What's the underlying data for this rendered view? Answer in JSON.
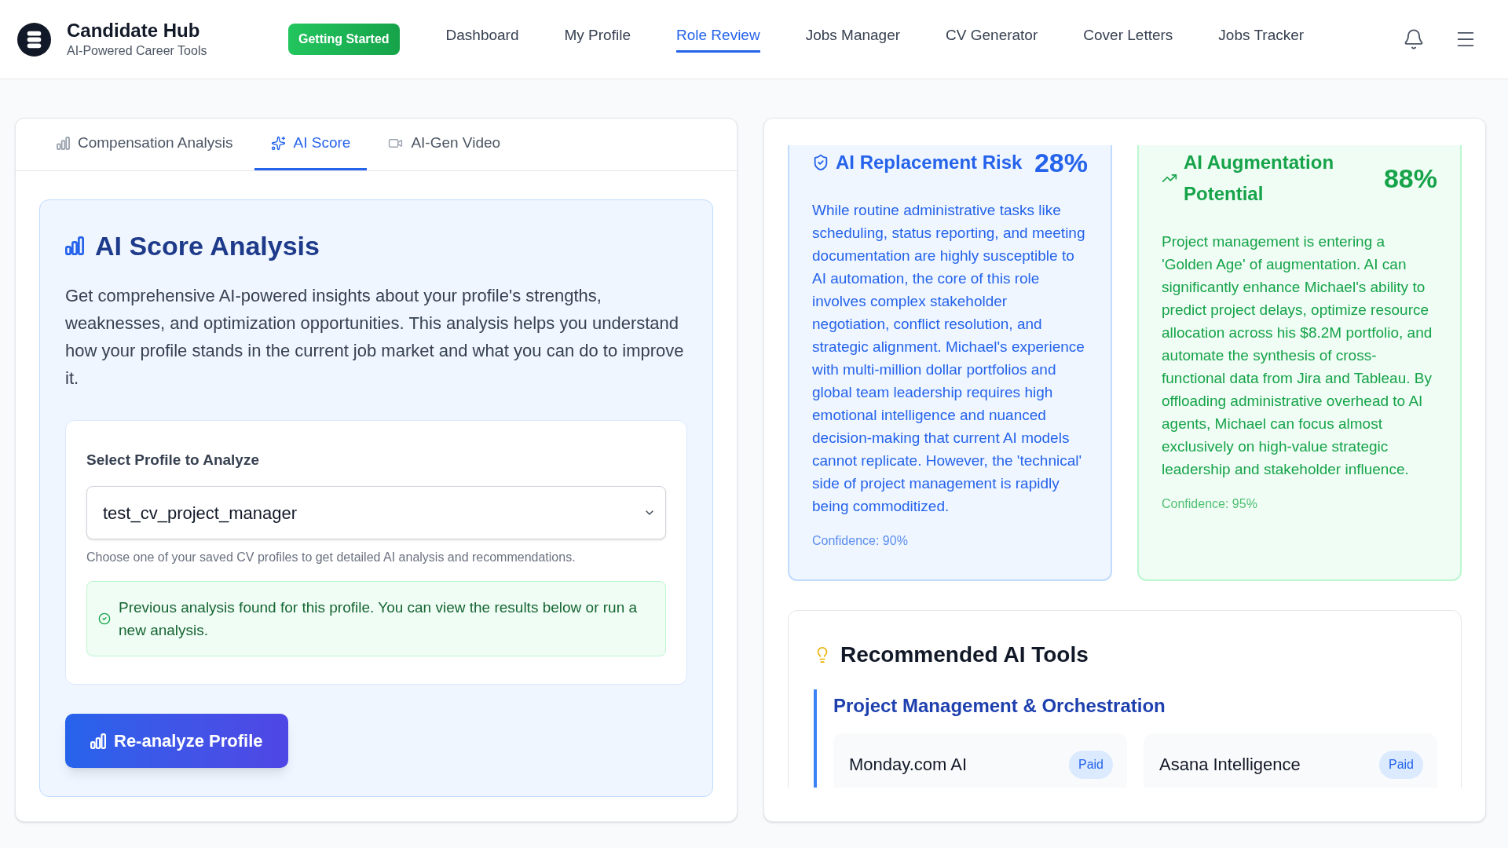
{
  "header": {
    "brand": {
      "title": "Candidate Hub",
      "subtitle": "AI-Powered Career Tools"
    },
    "cta": "Getting Started",
    "nav": [
      {
        "label": "Dashboard",
        "selected": false
      },
      {
        "label": "My Profile",
        "selected": false
      },
      {
        "label": "Role Review",
        "selected": true
      },
      {
        "label": "Jobs Manager",
        "selected": false
      },
      {
        "label": "CV Generator",
        "selected": false
      },
      {
        "label": "Cover Letters",
        "selected": false
      },
      {
        "label": "Jobs Tracker",
        "selected": false
      }
    ]
  },
  "left_panel": {
    "tabs": [
      {
        "label": "Compensation Analysis",
        "selected": false
      },
      {
        "label": "AI Score",
        "selected": true
      },
      {
        "label": "AI-Gen Video",
        "selected": false
      }
    ],
    "analysis": {
      "title": "AI Score Analysis",
      "description": "Get comprehensive AI-powered insights about your profile's strengths, weaknesses, and optimization opportunities. This analysis helps you understand how your profile stands in the current job market and what you can do to improve it.",
      "profile_select": {
        "label": "Select Profile to Analyze",
        "value": "test_cv_project_manager",
        "hint": "Choose one of your saved CV profiles to get detailed AI analysis and recommendations."
      },
      "notice": "Previous analysis found for this profile. You can view the results below or run a new analysis.",
      "button": "Re-analyze Profile"
    }
  },
  "right_panel": {
    "score_cards": [
      {
        "kind": "risk",
        "title": "AI Replacement Risk",
        "score": "28%",
        "description": "While routine administrative tasks like scheduling, status reporting, and meeting documentation are highly susceptible to AI automation, the core of this role involves complex stakeholder negotiation, conflict resolution, and strategic alignment. Michael's experience with multi-million dollar portfolios and global team leadership requires high emotional intelligence and nuanced decision-making that current AI models cannot replicate. However, the 'technical' side of project management is rapidly being commoditized.",
        "confidence": "Confidence: 90%"
      },
      {
        "kind": "augmentation",
        "title": "AI Augmentation Potential",
        "score": "88%",
        "description": "Project management is entering a 'Golden Age' of augmentation. AI can significantly enhance Michael's ability to predict project delays, optimize resource allocation across his $8.2M portfolio, and automate the synthesis of cross-functional data from Jira and Tableau. By offloading administrative overhead to AI agents, Michael can focus almost exclusively on high-value strategic leadership and stakeholder influence.",
        "confidence": "Confidence: 95%"
      }
    ],
    "recommended_tools": {
      "title": "Recommended AI Tools",
      "categories": [
        {
          "name": "Project Management & Orchestration",
          "tools": [
            {
              "name": "Monday.com AI",
              "pricing": "Paid"
            },
            {
              "name": "Asana Intelligence",
              "pricing": "Paid"
            }
          ]
        }
      ]
    }
  }
}
